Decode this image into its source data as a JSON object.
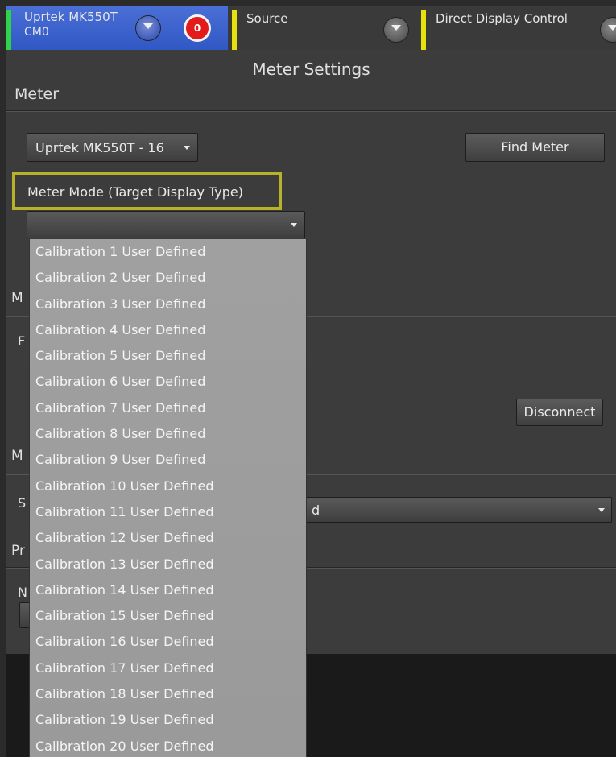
{
  "tabs": {
    "meter": {
      "line1": "Uprtek MK550T",
      "line2": "CM0",
      "accent": "#2fd24a"
    },
    "alert_count": "0",
    "source": {
      "label": "Source",
      "accent": "#e8e00a"
    },
    "direct": {
      "label": "Direct Display Control",
      "accent": "#e8e00a"
    }
  },
  "panel": {
    "title": "Meter Settings",
    "section_meter": "Meter",
    "meter_select_value": "Uprtek MK550T - 16",
    "find_meter_label": "Find Meter",
    "meter_mode_label": "Meter Mode (Target Display Type)",
    "meter_mode_value": "",
    "disconnect_label": "Disconnect",
    "partial": {
      "m1": "M",
      "f": "F",
      "m2": "M",
      "s": "S",
      "s_value_tail": "d",
      "p": "Pr",
      "n": "N"
    }
  },
  "dropdown_options": [
    "Calibration 1 User Defined",
    "Calibration 2 User Defined",
    "Calibration 3 User Defined",
    "Calibration 4 User Defined",
    "Calibration 5 User Defined",
    "Calibration 6 User Defined",
    "Calibration 7 User Defined",
    "Calibration 8 User Defined",
    "Calibration 9  User Defined",
    "Calibration 10  User Defined",
    "Calibration 11 User Defined",
    "Calibration 12 User Defined",
    "Calibration 13 User Defined",
    "Calibration 14 User Defined",
    "Calibration 15 User Defined",
    "Calibration 16 User Defined",
    "Calibration 17 User Defined",
    "Calibration 18 User Defined",
    "Calibration 19 User Defined",
    "Calibration 20 User Defined"
  ],
  "colors": {
    "highlight": "#b6b32a",
    "alert": "#e41b1b",
    "meter_tab": "#3157c4"
  }
}
